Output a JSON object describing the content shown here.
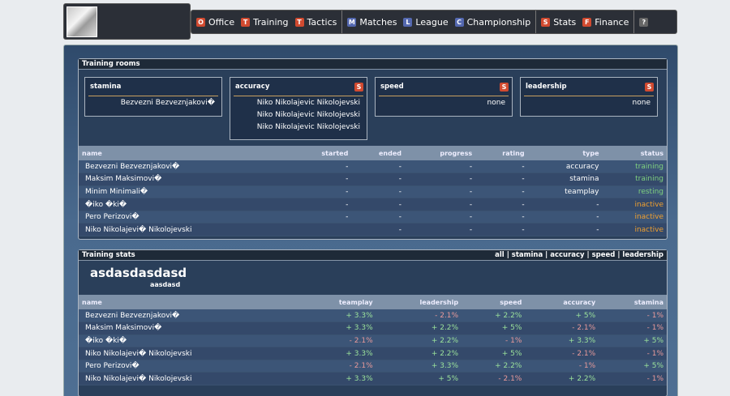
{
  "nav": {
    "groups": [
      [
        {
          "icon": "O",
          "label": "Office",
          "color": "#d14a30"
        },
        {
          "icon": "T",
          "label": "Training",
          "color": "#d14a30"
        },
        {
          "icon": "T",
          "label": "Tactics",
          "color": "#d14a30"
        }
      ],
      [
        {
          "icon": "M",
          "label": "Matches",
          "color": "#5468b0"
        },
        {
          "icon": "L",
          "label": "League",
          "color": "#5468b0"
        },
        {
          "icon": "C",
          "label": "Championship",
          "color": "#5468b0"
        }
      ],
      [
        {
          "icon": "S",
          "label": "Stats",
          "color": "#d14a30"
        },
        {
          "icon": "F",
          "label": "Finance",
          "color": "#d14a30"
        }
      ],
      [
        {
          "icon": "?",
          "label": "",
          "color": "#666"
        }
      ]
    ]
  },
  "rooms": {
    "title": "Training rooms",
    "items": [
      {
        "name": "stamina",
        "button": false,
        "players": [
          "Bezvezni Bezveznjakovi\u0000"
        ]
      },
      {
        "name": "accuracy",
        "button": true,
        "button_label": "S",
        "players": [
          "Niko Nikolajevic Nikolojevski",
          "Niko Nikolajevic Nikolojevski",
          "Niko Nikolajevic Nikolojevski"
        ]
      },
      {
        "name": "speed",
        "button": true,
        "button_label": "S",
        "players": [
          "none"
        ]
      },
      {
        "name": "leadership",
        "button": true,
        "button_label": "S",
        "players": [
          "none"
        ]
      }
    ],
    "columns": [
      "name",
      "started",
      "ended",
      "progress",
      "rating",
      "type",
      "status"
    ],
    "rows": [
      [
        "Bezvezni Bezveznjakovi\u0000",
        "-",
        "-",
        "-",
        "-",
        "accuracy",
        "training"
      ],
      [
        "Maksim Maksimovi\u0000",
        "-",
        "-",
        "-",
        "-",
        "stamina",
        "training"
      ],
      [
        "Minim Minimali\u0000",
        "-",
        "-",
        "-",
        "-",
        "teamplay",
        "resting"
      ],
      [
        "\u0000iko \u0000ki\u0000",
        "-",
        "-",
        "-",
        "-",
        "-",
        "inactive"
      ],
      [
        "Pero Perizovi\u0000",
        "-",
        "-",
        "-",
        "-",
        "-",
        "inactive"
      ],
      [
        "Niko Nikolajevi\u0000 Nikolojevski",
        "",
        "-",
        "-",
        "-",
        "-",
        "inactive"
      ]
    ]
  },
  "stats": {
    "title": "Training stats",
    "filters": [
      "all",
      "stamina",
      "accuracy",
      "speed",
      "leadership"
    ],
    "heading": "asdasdasdasd",
    "subheading": "aasdasd",
    "columns": [
      "name",
      "teamplay",
      "leadership",
      "speed",
      "accuracy",
      "stamina"
    ],
    "rows": [
      [
        "Bezvezni Bezveznjakovi\u0000",
        "+ 3.3%",
        "- 2.1%",
        "+ 2.2%",
        "+ 5%",
        "- 1%"
      ],
      [
        "Maksim Maksimovi\u0000",
        "+ 3.3%",
        "+ 2.2%",
        "+ 5%",
        "- 2.1%",
        "- 1%"
      ],
      [
        "\u0000iko \u0000ki\u0000",
        "- 2.1%",
        "+ 2.2%",
        "- 1%",
        "+ 3.3%",
        "+ 5%"
      ],
      [
        "Niko Nikolajevi\u0000 Nikolojevski",
        "+ 3.3%",
        "+ 2.2%",
        "+ 5%",
        "- 2.1%",
        "- 1%"
      ],
      [
        "Pero Perizovi\u0000",
        "- 2.1%",
        "+ 3.3%",
        "+ 2.2%",
        "- 1%",
        "+ 5%"
      ],
      [
        "Niko Nikolajevi\u0000 Nikolojevski",
        "+ 3.3%",
        "+ 5%",
        "- 2.1%",
        "+ 2.2%",
        "- 1%"
      ]
    ]
  }
}
